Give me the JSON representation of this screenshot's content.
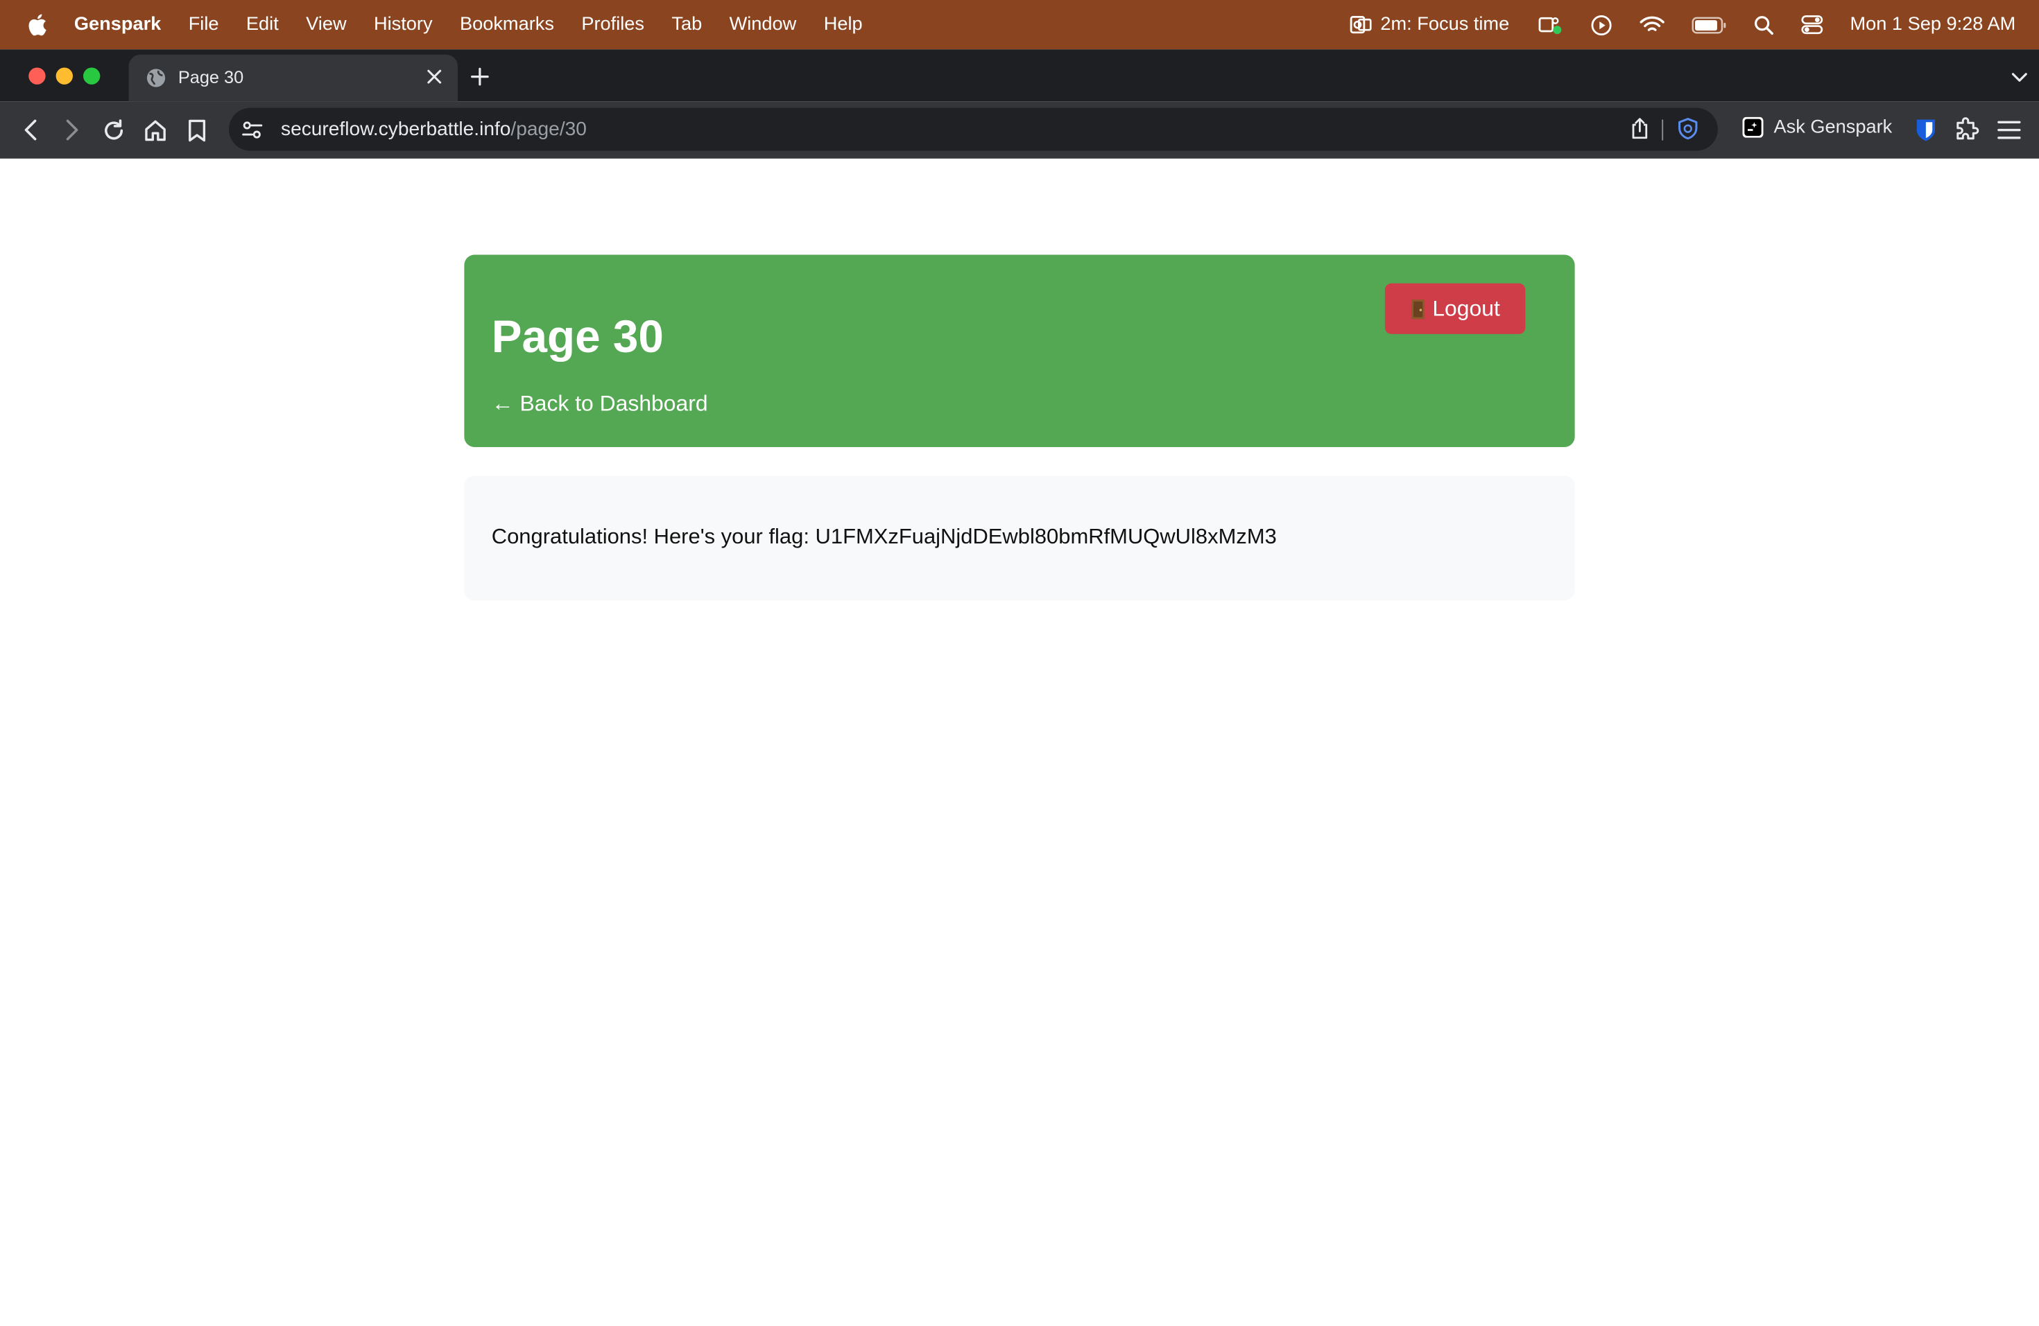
{
  "menubar": {
    "app_name": "Genspark",
    "items": [
      "File",
      "Edit",
      "View",
      "History",
      "Bookmarks",
      "Profiles",
      "Tab",
      "Window",
      "Help"
    ],
    "focus_status": "2m:  Focus time",
    "datetime": "Mon 1 Sep  9:28 AM"
  },
  "browser": {
    "tab": {
      "title": "Page 30"
    },
    "address_bar": {
      "domain": "secureflow.cyberbattle.info",
      "path": "/page/30"
    },
    "ask_genspark_label": "Ask Genspark"
  },
  "page": {
    "header": {
      "title": "Page 30",
      "back_link": "← Back to Dashboard",
      "logout_label": "Logout"
    },
    "content": {
      "message": "Congratulations! Here's your flag: U1FMXzFuajNjdDEwbl80bmRfMUQwUl8xMzM3"
    }
  },
  "colors": {
    "menubar_bg": "#8a4520",
    "header_green": "#54a853",
    "logout_red": "#cf3d49",
    "content_bg": "#f8f9fa"
  }
}
